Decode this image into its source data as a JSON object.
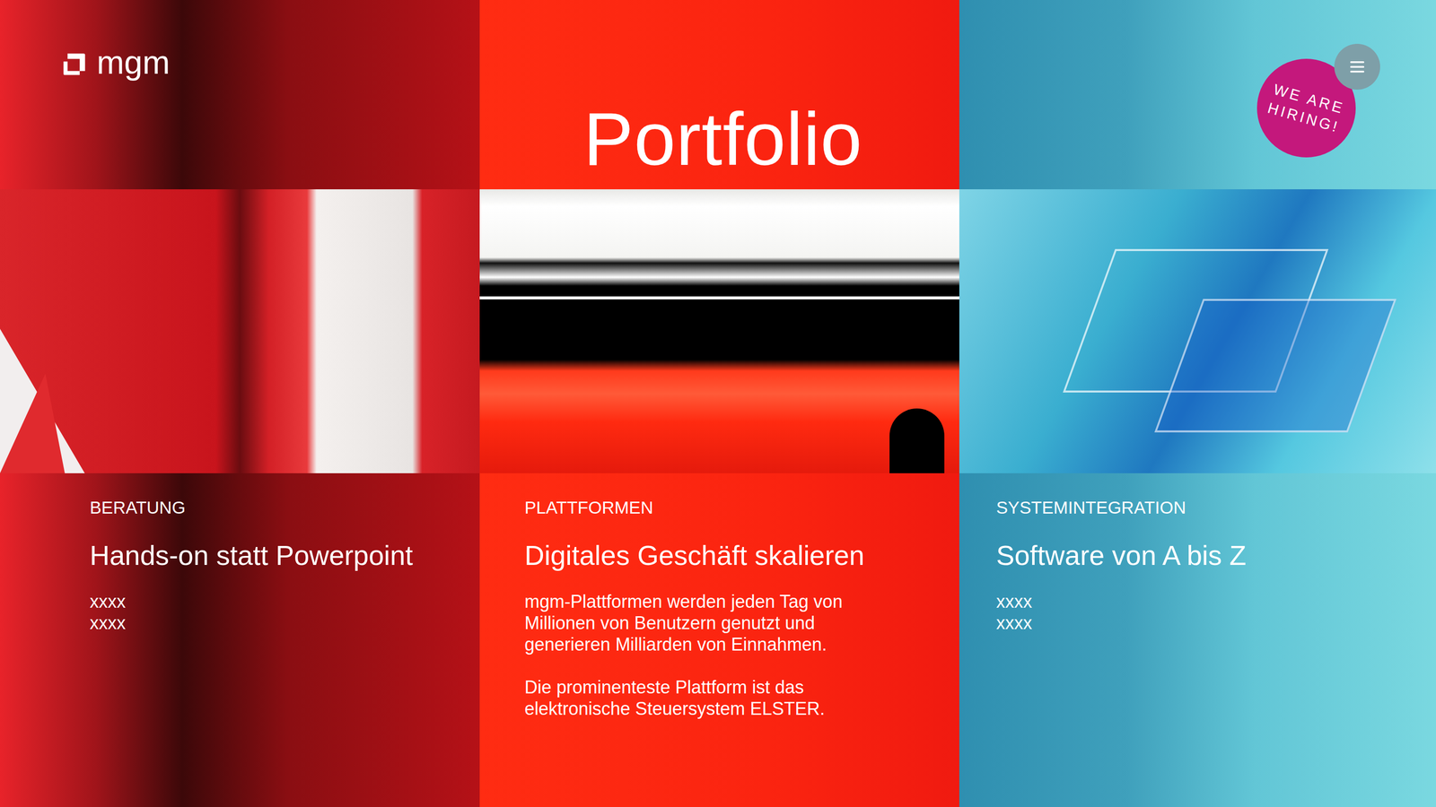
{
  "header": {
    "logo": "mgm",
    "title": "Portfolio"
  },
  "badge": {
    "lines": [
      "WE ARE",
      "HIRING!"
    ]
  },
  "columns": [
    {
      "category": "BERATUNG",
      "heading": "Hands-on statt Powerpoint",
      "paragraphs": [
        [
          "xxxx",
          "xxxx"
        ]
      ]
    },
    {
      "category": "PLATTFORMEN",
      "heading": "Digitales Geschäft skalieren",
      "paragraphs": [
        [
          "mgm-Plattformen werden jeden Tag von Millionen von Benutzern genutzt und generieren Milliarden von Einnahmen."
        ],
        [
          "Die prominenteste Plattform ist das elektronische Steuersystem ELSTER."
        ]
      ]
    },
    {
      "category": "SYSTEMINTEGRATION",
      "heading": "Software von A bis Z",
      "paragraphs": [
        [
          "xxxx",
          "xxxx"
        ]
      ]
    }
  ]
}
